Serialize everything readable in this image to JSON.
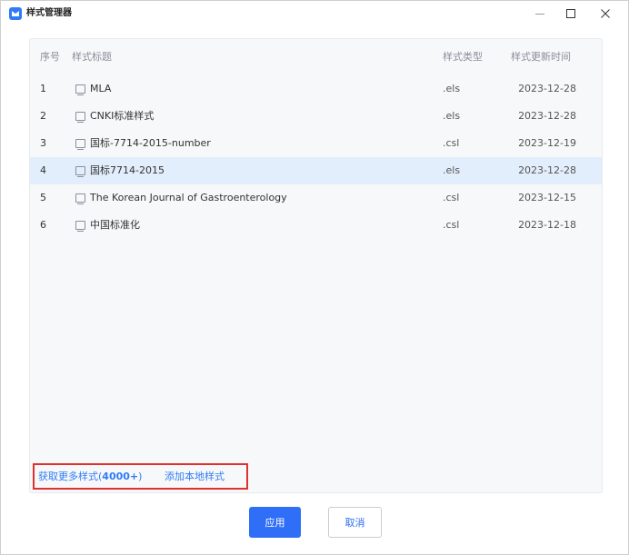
{
  "window": {
    "title": "样式管理器",
    "controls": {
      "minimize": "minimize-icon",
      "maximize": "maximize-icon",
      "close": "close-icon"
    }
  },
  "table": {
    "columns": {
      "index": "序号",
      "title": "样式标题",
      "type": "样式类型",
      "date": "样式更新时间"
    },
    "rows": [
      {
        "index": "1",
        "title": "MLA",
        "type": ".els",
        "date": "2023-12-28",
        "selected": false
      },
      {
        "index": "2",
        "title": "CNKI标准样式",
        "type": ".els",
        "date": "2023-12-28",
        "selected": false
      },
      {
        "index": "3",
        "title": "国标-7714-2015-number",
        "type": ".csl",
        "date": "2023-12-19",
        "selected": false
      },
      {
        "index": "4",
        "title": "国标7714-2015",
        "type": ".els",
        "date": "2023-12-28",
        "selected": true
      },
      {
        "index": "5",
        "title": "The Korean Journal of Gastroenterology",
        "type": ".csl",
        "date": "2023-12-15",
        "selected": false
      },
      {
        "index": "6",
        "title": "中国标准化",
        "type": ".csl",
        "date": "2023-12-18",
        "selected": false
      }
    ]
  },
  "links": {
    "get_more_prefix": "获取更多样式(",
    "get_more_count": "4000+",
    "get_more_suffix": ")",
    "add_local": "添加本地样式"
  },
  "buttons": {
    "apply": "应用",
    "cancel": "取消"
  },
  "colors": {
    "accent": "#2f6ef6",
    "selected_row": "#e3eefd",
    "highlight_box": "#e0302f"
  }
}
